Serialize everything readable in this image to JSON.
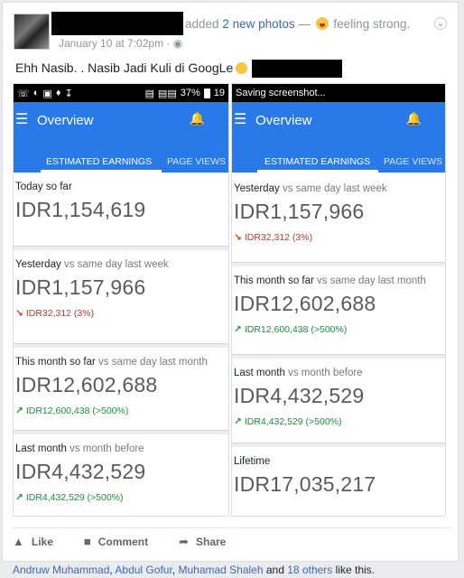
{
  "post": {
    "action_prefix": "added",
    "action_link": "2 new photos",
    "action_dash": "—",
    "feeling": "feeling strong.",
    "timestamp": "January 10 at 7:02pm ·",
    "text": "Ehh Nasib. . Nasib Jadi Kuli di GoogLe"
  },
  "left_screenshot": {
    "status_battery": "37%",
    "status_time": "19",
    "app_title": "Overview",
    "tab_active": "ESTIMATED EARNINGS",
    "tab_inactive": "PAGE VIEWS",
    "cards": [
      {
        "label": "Today so far",
        "sub": "",
        "value": "IDR1,154,619",
        "change": "",
        "direction": "none"
      },
      {
        "label": "Yesterday",
        "sub": "vs same day last week",
        "value": "IDR1,157,966",
        "change": "IDR32,312 (3%)",
        "direction": "down"
      },
      {
        "label": "This month so far",
        "sub": "vs same day last month",
        "value": "IDR12,602,688",
        "change": "IDR12,600,438 (>500%)",
        "direction": "up"
      },
      {
        "label": "Last month",
        "sub": "vs month before",
        "value": "IDR4,432,529",
        "change": "IDR4,432,529 (>500%)",
        "direction": "up"
      }
    ]
  },
  "right_screenshot": {
    "status_text": "Saving screenshot...",
    "app_title": "Overview",
    "tab_active": "ESTIMATED EARNINGS",
    "tab_inactive": "PAGE VIEWS",
    "cards": [
      {
        "label": "Yesterday",
        "sub": "vs same day last week",
        "value": "IDR1,157,966",
        "change": "IDR32,312 (3%)",
        "direction": "down"
      },
      {
        "label": "This month so far",
        "sub": "vs same day last month",
        "value": "IDR12,602,688",
        "change": "IDR12,600,438 (>500%)",
        "direction": "up"
      },
      {
        "label": "Last month",
        "sub": "vs month before",
        "value": "IDR4,432,529",
        "change": "IDR4,432,529 (>500%)",
        "direction": "up"
      },
      {
        "label": "Lifetime",
        "sub": "",
        "value": "IDR17,035,217",
        "change": "",
        "direction": "none"
      }
    ]
  },
  "actions": {
    "like": "Like",
    "comment": "Comment",
    "share": "Share"
  },
  "likes": {
    "name1": "Andruw Muhammad",
    "sep1": ",",
    "name2": "Abdul Gofur",
    "sep2": ",",
    "name3": "Muhamad Shaleh",
    "and": "and",
    "others": "18 others",
    "suffix": "like this."
  },
  "icons": {
    "bell": "bell-icon",
    "menu": "menu-icon",
    "like": "thumbs-up-icon",
    "comment": "comment-icon",
    "share": "share-arrow-icon",
    "chevron": "chevron-down-icon",
    "globe": "globe-icon",
    "trend_up": "trend-up-icon",
    "trend_down": "trend-down-icon"
  },
  "colors": {
    "appbar": "#2979e8",
    "link": "#4267b2",
    "up": "#1e8e3e",
    "down": "#c23b2c"
  }
}
